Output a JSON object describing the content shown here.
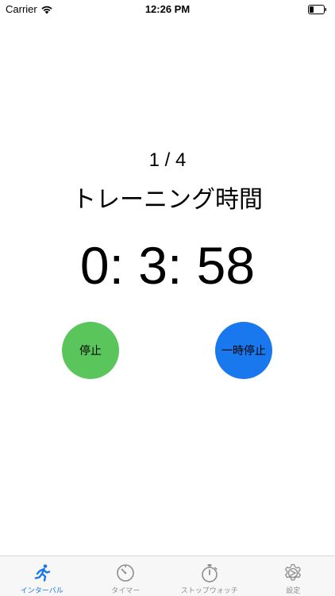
{
  "status_bar": {
    "carrier": "Carrier",
    "time": "12:26 PM"
  },
  "timer": {
    "round": "1 / 4",
    "phase": "トレーニング時間",
    "time": "0: 3: 58"
  },
  "buttons": {
    "stop_label": "停止",
    "pause_label": "一時停止",
    "stop_color": "#5ac55a",
    "pause_color": "#1a78ee"
  },
  "tab_bar": {
    "active_color": "#1a78e6",
    "inactive_color": "#8e8e8e",
    "tabs": [
      {
        "label": "インターバル",
        "icon": "runner-icon",
        "active": true
      },
      {
        "label": "タイマー",
        "icon": "timer-icon",
        "active": false
      },
      {
        "label": "ストップウォッチ",
        "icon": "stopwatch-icon",
        "active": false
      },
      {
        "label": "設定",
        "icon": "gear-icon",
        "active": false
      }
    ]
  }
}
